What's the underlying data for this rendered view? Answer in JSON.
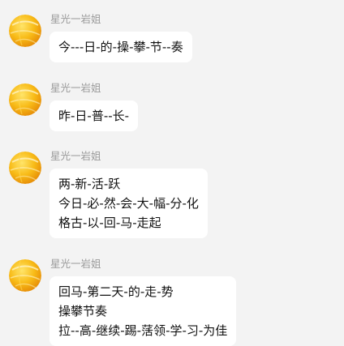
{
  "messages": [
    {
      "sender": "星光一岩姐",
      "lines": [
        "今---日-的-操-攀-节--奏"
      ]
    },
    {
      "sender": "星光一岩姐",
      "lines": [
        "昨-日-普--长-"
      ]
    },
    {
      "sender": "星光一岩姐",
      "lines": [
        "两-新-活-跃",
        "今日-必-然-会-大-幅-分-化",
        "格古-以-回-马-走起"
      ]
    },
    {
      "sender": "星光一岩姐",
      "lines": [
        "回马-第二天-的-走-势",
        "操攀节奏",
        "拉--高-继续-踢-萿领-学-习-为佳"
      ]
    }
  ],
  "avatar_icon": "star-ball-avatar-icon",
  "colors": {
    "background": "#f3f3f3",
    "bubble": "#ffffff",
    "sender_text": "#9a9a9a",
    "message_text": "#111111",
    "avatar_primary": "#f6b414"
  }
}
